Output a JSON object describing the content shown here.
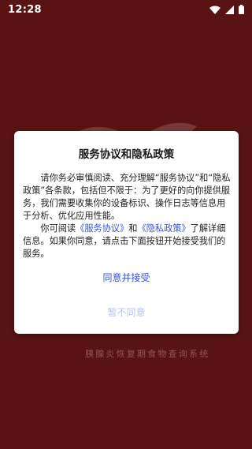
{
  "status_bar": {
    "time": "12:28",
    "icons": [
      "wifi-icon",
      "cell-signal-icon",
      "battery-icon"
    ]
  },
  "background": {
    "app_subtitle": "胰腺炎恢复期食物查询系统",
    "logo_icon": "wings-logo-icon"
  },
  "dialog": {
    "title": "服务协议和隐私政策",
    "para1": "请你务必审慎阅读、充分理解“服务协议”和“隐私政策”各条款，包括但不限于：为了更好的向你提供服务，我们需要收集你的设备标识、操作日志等信息用于分析、优化应用性能。",
    "para2_prefix": "你可阅读",
    "service_link": "《服务协议》",
    "para2_and": "和",
    "privacy_link": "《隐私政策》",
    "para2_suffix": "了解详细信息。如果你同意，请点击下面按钮开始接受我们的服务。",
    "agree_label": "同意并接受",
    "disagree_label": "暂不同意"
  },
  "colors": {
    "background": "#5a1313",
    "link": "#3a55d6",
    "disabled_button": "#b9c3ea",
    "dialog_bg": "#ffffff"
  }
}
